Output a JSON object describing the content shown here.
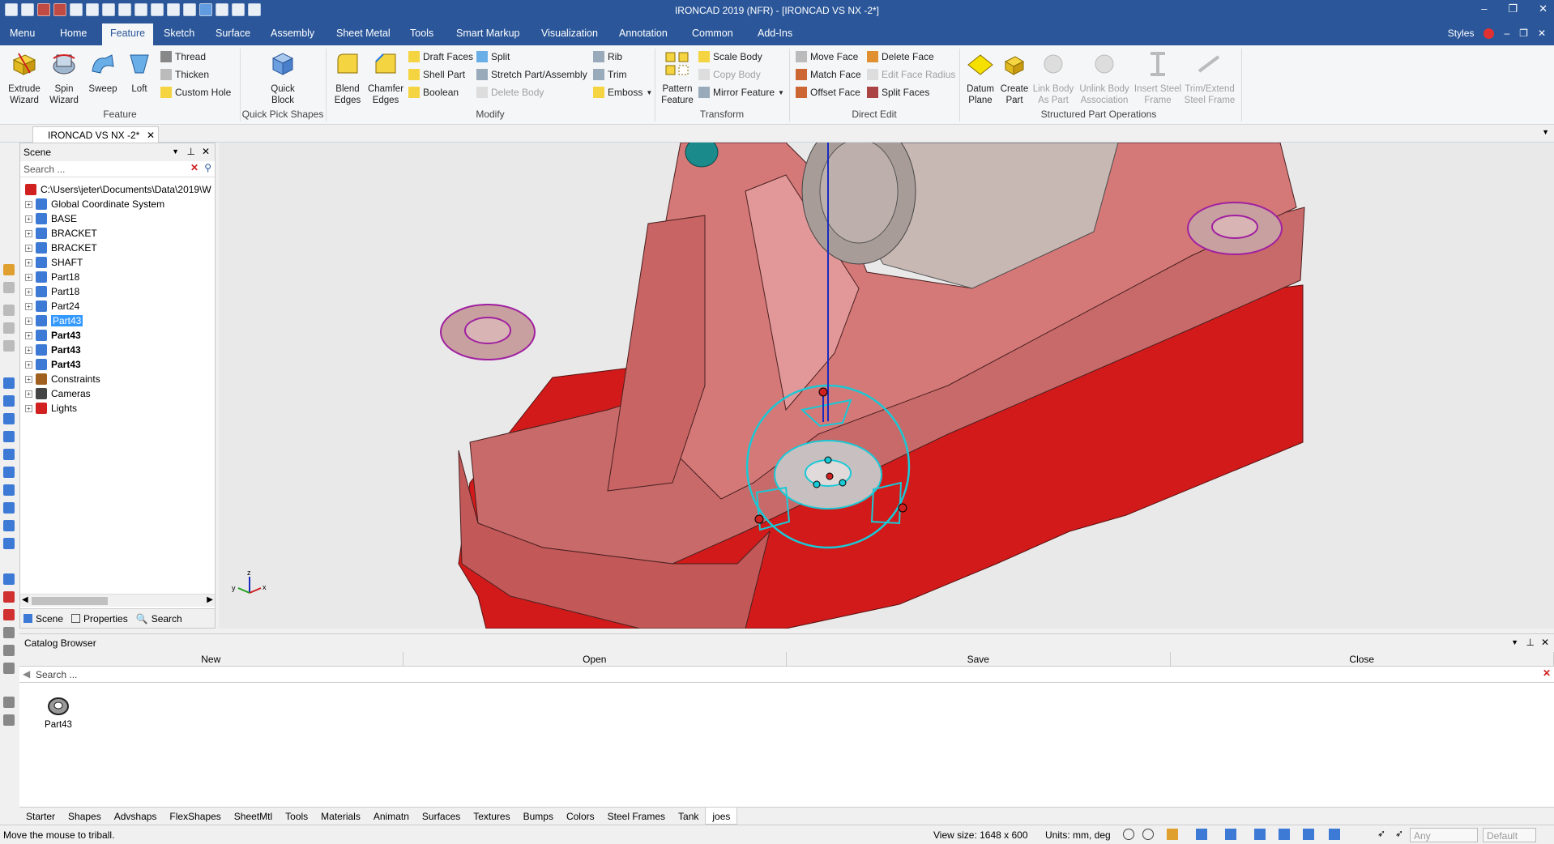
{
  "title": "IRONCAD 2019 (NFR) - [IRONCAD VS NX -2*]",
  "window_controls": {
    "minimize": "–",
    "restore": "❐",
    "close": "✕"
  },
  "menu_tabs": [
    "Menu",
    "Home",
    "Feature",
    "Sketch",
    "Surface",
    "Assembly",
    "Sheet Metal",
    "Tools",
    "Smart Markup",
    "Visualization",
    "Annotation",
    "Common",
    "Add-Ins"
  ],
  "active_tab": "Feature",
  "styles_label": "Styles",
  "ribbon": {
    "feature": {
      "extrude": "Extrude Wizard",
      "spin": "Spin Wizard",
      "sweep": "Sweep",
      "loft": "Loft",
      "thread": "Thread",
      "thicken": "Thicken",
      "custom_hole": "Custom Hole",
      "group": "Feature"
    },
    "quick": {
      "quick_block": "Quick Block",
      "group": "Quick Pick Shapes"
    },
    "modify": {
      "blend": "Blend Edges",
      "chamfer": "Chamfer Edges",
      "draft": "Draft Faces",
      "shell": "Shell Part",
      "boolean": "Boolean",
      "split": "Split",
      "stretch": "Stretch Part/Assembly",
      "delete_body": "Delete Body",
      "rib": "Rib",
      "trim": "Trim",
      "emboss": "Emboss",
      "group": "Modify"
    },
    "transform": {
      "pattern": "Pattern Feature",
      "scale": "Scale Body",
      "copy": "Copy Body",
      "mirror": "Mirror Feature",
      "group": "Transform"
    },
    "direct_edit": {
      "move_face": "Move Face",
      "match_face": "Match Face",
      "offset_face": "Offset Face",
      "delete_face": "Delete Face",
      "edit_face_radius": "Edit Face Radius",
      "split_faces": "Split Faces",
      "group": "Direct Edit"
    },
    "structured": {
      "datum": "Datum Plane",
      "create_part": "Create Part",
      "link_body": "Link Body As Part",
      "unlink_body": "Unlink Body Association",
      "insert_steel": "Insert Steel Frame",
      "trim_steel": "Trim/Extend Steel Frame",
      "group": "Structured Part Operations"
    }
  },
  "doc_tab": "IRONCAD VS NX -2*",
  "scene": {
    "title": "Scene",
    "search_placeholder": "Search ...",
    "root": "C:\\Users\\jeter\\Documents\\Data\\2019\\W",
    "items": [
      {
        "label": "Global Coordinate System",
        "state": "normal"
      },
      {
        "label": "BASE",
        "state": "normal"
      },
      {
        "label": "BRACKET",
        "state": "normal"
      },
      {
        "label": "BRACKET",
        "state": "normal"
      },
      {
        "label": "SHAFT",
        "state": "normal"
      },
      {
        "label": "Part18",
        "state": "normal"
      },
      {
        "label": "Part18",
        "state": "normal"
      },
      {
        "label": "Part24",
        "state": "normal"
      },
      {
        "label": "Part43",
        "state": "selected"
      },
      {
        "label": "Part43",
        "state": "bold"
      },
      {
        "label": "Part43",
        "state": "bold"
      },
      {
        "label": "Part43",
        "state": "bold"
      },
      {
        "label": "Constraints",
        "state": "normal"
      },
      {
        "label": "Cameras",
        "state": "normal"
      },
      {
        "label": "Lights",
        "state": "normal"
      }
    ],
    "tabs": [
      "Scene",
      "Properties",
      "Search"
    ]
  },
  "catalog": {
    "title": "Catalog Browser",
    "buttons": [
      "New",
      "Open",
      "Save",
      "Close"
    ],
    "search_placeholder": "Search ...",
    "item": "Part43"
  },
  "bottom_tabs": [
    "Starter",
    "Shapes",
    "Advshaps",
    "FlexShapes",
    "SheetMtl",
    "Tools",
    "Materials",
    "Animatn",
    "Surfaces",
    "Textures",
    "Bumps",
    "Colors",
    "Steel Frames",
    "Tank",
    "joes"
  ],
  "active_bottom_tab": "joes",
  "status": {
    "message": "Move the mouse to triball.",
    "view_size": "View size: 1648 x 600",
    "units": "Units: mm, deg",
    "combo1": "Any",
    "combo2": "Default"
  },
  "colors": {
    "title_bar": "#2b579a",
    "part_pink": "#d06a6a",
    "part_red": "#d21a1a",
    "triball": "#19c9d6"
  }
}
